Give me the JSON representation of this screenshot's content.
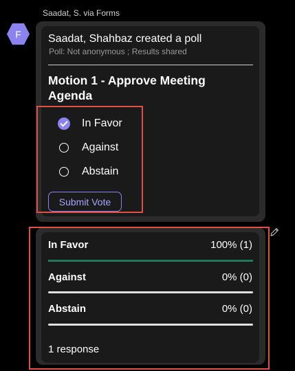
{
  "message": {
    "sender": "Saadat, S. via Forms",
    "avatar_letter": "F",
    "avatar_color": "#8b84f0"
  },
  "poll": {
    "title": "Saadat, Shahbaz created a poll",
    "subtitle": "Poll: Not anonymous ; Results shared",
    "question": "Motion 1 - Approve Meeting Agenda",
    "options": [
      {
        "label": "In Favor",
        "selected": true
      },
      {
        "label": "Against",
        "selected": false
      },
      {
        "label": "Abstain",
        "selected": false
      }
    ],
    "submit_label": "Submit Vote"
  },
  "results": {
    "items": [
      {
        "label": "In Favor",
        "value": "100% (1)",
        "fraction": 1.0
      },
      {
        "label": "Against",
        "value": "0% (0)",
        "fraction": 0.0
      },
      {
        "label": "Abstain",
        "value": "0% (0)",
        "fraction": 0.0
      }
    ],
    "responses": "1 response"
  },
  "colors": {
    "accent": "#8b84f0",
    "result_fill": "#1f7a5c",
    "highlight": "#e15048"
  },
  "icons": {
    "edit": "pencil-icon",
    "selected": "check-circle-icon"
  }
}
